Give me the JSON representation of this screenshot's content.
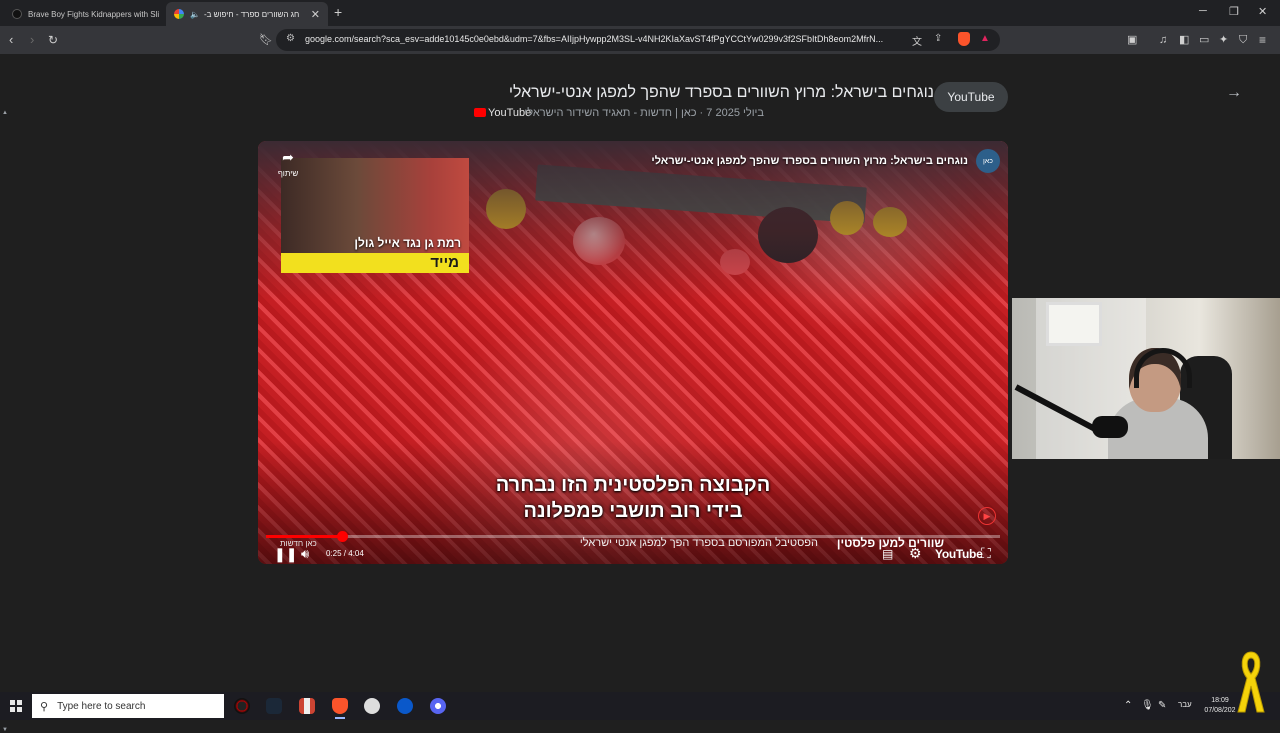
{
  "tabs": [
    {
      "title": "Brave Boy Fights Kidnappers with Sli"
    },
    {
      "title": "חג השוורים ספרד - חיפוש ב-"
    }
  ],
  "toolbar": {
    "url": "google.com/search?sca_esv=adde10145c0e0ebd&udm=7&fbs=AIIjpHywpp2M3SL-v4NH2KIaXavST4fPgYCCtYw0299v3f2SFbItDh8eom2MfrN..."
  },
  "result": {
    "title": "נוגחים בישראל: מרוץ השוורים בספרד שהפך למפגן אנטי-ישראלי",
    "source_chip": "YouTube",
    "meta": "ביולי 2025 7 · כאן | חדשות - תאגיד השידור הישראלי",
    "source": "YouTube"
  },
  "video": {
    "overlay_title": "נוגחים בישראל: מרוץ השוורים בספרד שהפך למפגן אנטי-ישראלי",
    "share_label": "שיתוף",
    "inset_caption": "רמת גן נגד אייל גולן",
    "inset_flag": "מייד",
    "subtitle_line1": "הקבוצה הפלסטינית הזו נבחרה",
    "subtitle_line2": "בידי רוב תושבי פמפלונה",
    "ticker_main": "שוורים למען פלסטין",
    "ticker_sub": "הפסטיבל המפורסם בספרד הפך למפגן אנטי ישראלי",
    "channel_tag": "כאן חדשות",
    "time": "0:25 / 4:04",
    "progress": 0.103,
    "brand": "YouTube"
  },
  "taskbar": {
    "search_placeholder": "Type here to search",
    "lang": "עבר",
    "time": "18:09",
    "date": "07/08/202"
  },
  "colors": {
    "accent_red": "#ff0000",
    "page_bg": "#1f1f1f",
    "ribbon_yellow": "#f5d30a"
  }
}
